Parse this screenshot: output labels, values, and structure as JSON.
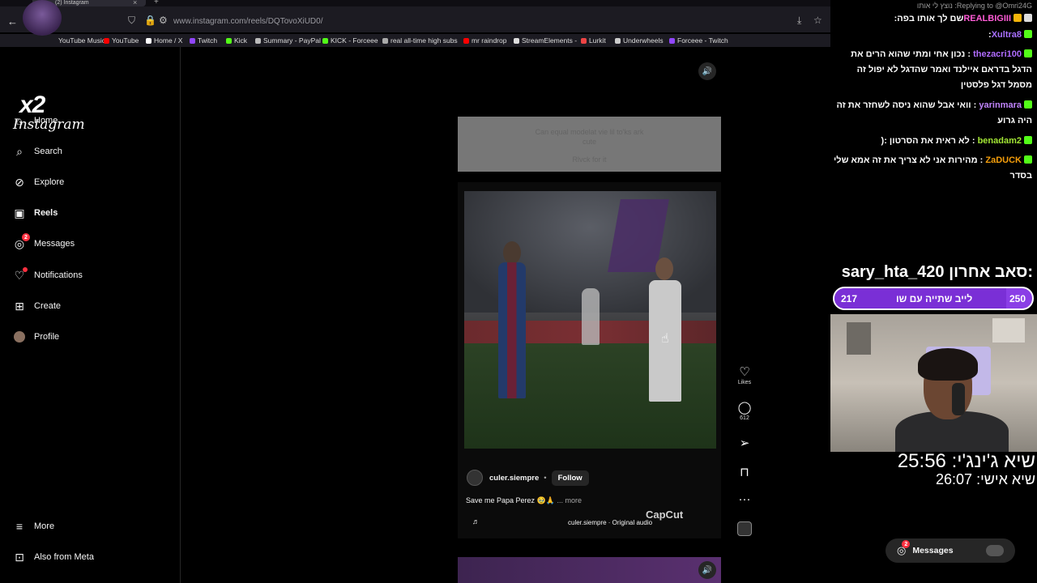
{
  "browser": {
    "url": "www.instagram.com/reels/DQTovoXiUD0/",
    "tab_title": "(2) Instagram",
    "bookmarks": [
      "YouTube Music",
      "YouTube",
      "Home / X",
      "Twitch",
      "Kick",
      "Summary - PayPal",
      "KICK - Forceee",
      "real all-time high subs",
      "mr raindrop",
      "StreamElements -",
      "Lurkit",
      "Underwheels",
      "Forceee - Twitch"
    ]
  },
  "overlay": {
    "multiplier": "x2"
  },
  "sidebar": {
    "logo": "Instagram",
    "items": [
      {
        "label": "Home",
        "icon": "home-icon"
      },
      {
        "label": "Search",
        "icon": "search-icon"
      },
      {
        "label": "Explore",
        "icon": "compass-icon"
      },
      {
        "label": "Reels",
        "icon": "reels-icon"
      },
      {
        "label": "Messages",
        "icon": "messenger-icon",
        "badge": "2"
      },
      {
        "label": "Notifications",
        "icon": "heart-icon"
      },
      {
        "label": "Create",
        "icon": "plus-square-icon"
      },
      {
        "label": "Profile",
        "icon": "avatar-icon"
      }
    ],
    "more": "More",
    "meta": "Also from Meta"
  },
  "notice": {
    "line1": "Can equal modelat vie lil to'ks ark",
    "line2": "cute",
    "line3": "Rlvck for it"
  },
  "reel": {
    "author": "culer.siempre",
    "separator": "•",
    "follow": "Follow",
    "caption": "Save me Papa Perez 🥹🙏",
    "more": "... more",
    "audio": "culer.siempre · Original audio",
    "watermark": "CapCut",
    "likes_label": "Likes",
    "comments_count": "612"
  },
  "chat": {
    "reply_header": "Replying to @Omri24G: נוצץ לי אותו",
    "messages": [
      {
        "user": "REALBIGIII",
        "text": "שם לך אותו בפה:",
        "color": "#ff5cd6"
      },
      {
        "user": "Xultra8",
        "text": ":",
        "color": "#a970ff"
      },
      {
        "user": "thezacri100",
        "text": ": נכון אחי ומתי שהוא הרים את הדגל בדראם איילנד ואמר שהדגל לא יפול זה מסמל דגל פלסטין",
        "color": "#b06cff"
      },
      {
        "user": "yarinmara",
        "text": ": וואי אבל שהוא ניסה לשחזר את זה היה גרוע",
        "color": "#c084fc"
      },
      {
        "user": "benadam2",
        "text": ": לא ראית את הסרטון :(",
        "color": "#a3e635"
      },
      {
        "user": "ZaDUCK",
        "text": ": מהירות אני לא צריך את זה אמא שלי בסדר",
        "color": "#f59e0b"
      }
    ]
  },
  "stream": {
    "last_sub_label": "סאב אחרון:",
    "last_sub": "sary_hta_420",
    "goal_text": "לייב שתייה עם שו",
    "goal_current": "217",
    "goal_target": "250",
    "goal_progress": 0.868,
    "record_team_label": "שיא ג'ינג'י:",
    "record_team": "25:56",
    "record_personal_label": "שיא אישי:",
    "record_personal": "26:07"
  },
  "messages_pill": {
    "label": "Messages",
    "badge": "2"
  },
  "colors": {
    "accent": "#8a3ee6",
    "badge": "#ff3040",
    "kick": "#53fc18"
  }
}
